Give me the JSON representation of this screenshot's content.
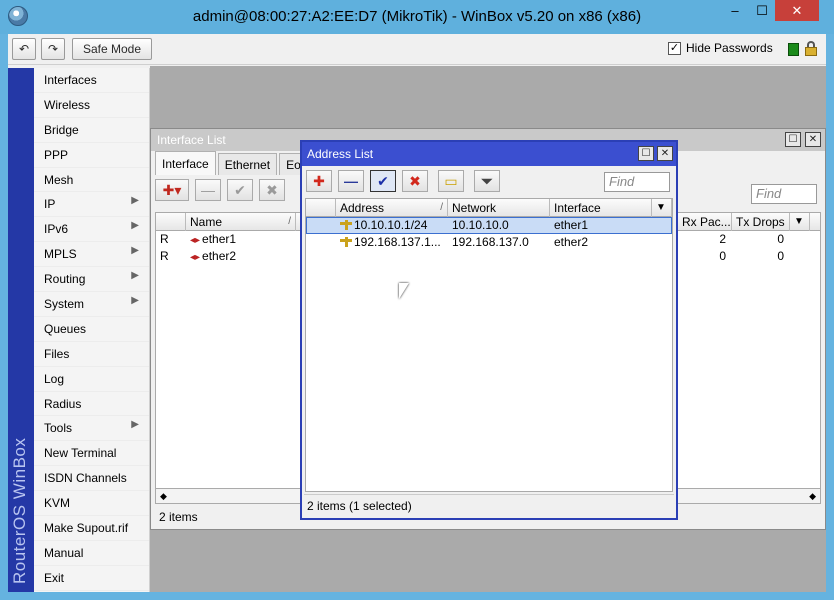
{
  "window": {
    "title": "admin@08:00:27:A2:EE:D7 (MikroTik) - WinBox v5.20 on x86 (x86)",
    "controls": {
      "minimize": "–",
      "maximize": "☐",
      "close": "✕"
    }
  },
  "toolbar": {
    "undo_icon": "↶",
    "redo_icon": "↷",
    "safe_mode_label": "Safe Mode",
    "hide_passwords_label": "Hide Passwords",
    "hide_passwords_checked": "✓"
  },
  "sidebar": {
    "brand": "RouterOS WinBox",
    "items": [
      {
        "label": "Interfaces",
        "submenu": ""
      },
      {
        "label": "Wireless",
        "submenu": ""
      },
      {
        "label": "Bridge",
        "submenu": ""
      },
      {
        "label": "PPP",
        "submenu": ""
      },
      {
        "label": "Mesh",
        "submenu": ""
      },
      {
        "label": "IP",
        "submenu": "▶"
      },
      {
        "label": "IPv6",
        "submenu": "▶"
      },
      {
        "label": "MPLS",
        "submenu": "▶"
      },
      {
        "label": "Routing",
        "submenu": "▶"
      },
      {
        "label": "System",
        "submenu": "▶"
      },
      {
        "label": "Queues",
        "submenu": ""
      },
      {
        "label": "Files",
        "submenu": ""
      },
      {
        "label": "Log",
        "submenu": ""
      },
      {
        "label": "Radius",
        "submenu": ""
      },
      {
        "label": "Tools",
        "submenu": "▶"
      },
      {
        "label": "New Terminal",
        "submenu": ""
      },
      {
        "label": "ISDN Channels",
        "submenu": ""
      },
      {
        "label": "KVM",
        "submenu": ""
      },
      {
        "label": "Make Supout.rif",
        "submenu": ""
      },
      {
        "label": "Manual",
        "submenu": ""
      },
      {
        "label": "Exit",
        "submenu": ""
      }
    ]
  },
  "interface_list": {
    "title": "Interface List",
    "tabs": [
      "Interface",
      "Ethernet",
      "Eo"
    ],
    "buttons": {
      "add": "✚▾",
      "remove": "—",
      "enable": "✔",
      "disable": "✖"
    },
    "find_placeholder": "Find",
    "columns": {
      "flag": "",
      "name": "Name",
      "sort": "/",
      "rx_packets": "Rx Pac...",
      "tx_drops": "Tx Drops",
      "menu": "▼"
    },
    "rows": [
      {
        "flag": "R",
        "name": "ether1",
        "rx_tail": "8",
        "rx_packets": "2",
        "tx_drops": "0"
      },
      {
        "flag": "R",
        "name": "ether2",
        "rx_tail": "0",
        "rx_packets": "0",
        "tx_drops": "0"
      }
    ],
    "scroll_left": "◆",
    "scroll_right": "◆",
    "status": "2 items"
  },
  "address_list": {
    "title": "Address List",
    "buttons": {
      "add": "✚",
      "remove": "—",
      "enable": "✔",
      "disable": "✖",
      "comment": "▭",
      "filter": "⏷"
    },
    "find_placeholder": "Find",
    "columns": {
      "address": "Address",
      "sort": "/",
      "network": "Network",
      "interface": "Interface",
      "menu": "▼"
    },
    "rows": [
      {
        "address": "10.10.10.1/24",
        "network": "10.10.10.0",
        "interface": "ether1",
        "selected": true
      },
      {
        "address": "192.168.137.1...",
        "network": "192.168.137.0",
        "interface": "ether2",
        "selected": false
      }
    ],
    "status": "2 items (1 selected)"
  },
  "colors": {
    "titlebar": "#5fb0dd",
    "brand_strip": "#2438a6",
    "active_window": "#3b4fd0",
    "selection": "#c9dcf6"
  }
}
